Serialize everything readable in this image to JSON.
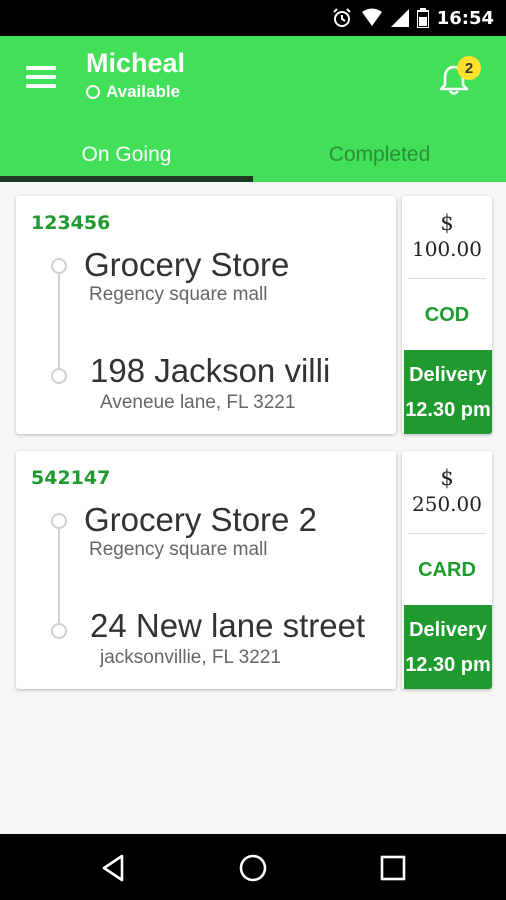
{
  "status_bar": {
    "time": "16:54"
  },
  "header": {
    "user_name": "Micheal",
    "user_status": "Available",
    "notification_count": "2"
  },
  "tabs": [
    {
      "label": "On Going"
    },
    {
      "label": "Completed"
    }
  ],
  "orders": [
    {
      "id": "123456",
      "pickup_name": "Grocery Store",
      "pickup_address": "Regency square mall",
      "drop_name": "198 Jackson villi",
      "drop_address": "Aveneue lane, FL 3221",
      "currency": "$",
      "amount": "100.00",
      "payment": "COD",
      "delivery_label": "Delivery",
      "delivery_time": "12.30 pm"
    },
    {
      "id": "542147",
      "pickup_name": "Grocery Store 2",
      "pickup_address": "Regency square mall",
      "drop_name": "24 New lane street",
      "drop_address": "jacksonvillie, FL 3221",
      "currency": "$",
      "amount": "250.00",
      "payment": "CARD",
      "delivery_label": "Delivery",
      "delivery_time": "12.30 pm"
    }
  ],
  "colors": {
    "primary": "#42df58",
    "accent_dark": "#1f9a2e",
    "badge": "#ffe12b"
  }
}
